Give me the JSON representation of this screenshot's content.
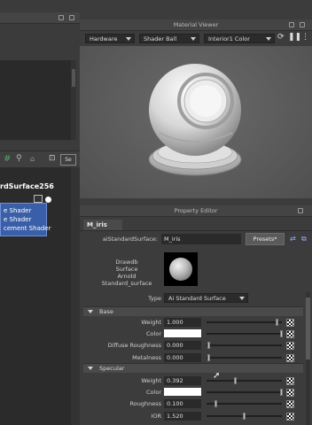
{
  "material_viewer": {
    "title": "Material Viewer",
    "renderer": "Hardware",
    "geometry": "Shader Ball",
    "environment": "Interior1 Color"
  },
  "hypershade_left": {
    "node_title": "rdSurface256",
    "node_rows": [
      "e Shader",
      "e Shader",
      "cement Shader"
    ],
    "toolbar_button": "Se"
  },
  "property_editor": {
    "title": "Property Editor",
    "tab": "M_iris",
    "node_type_label": "aiStandardSurface:",
    "node_name": "M_iris",
    "presets_label": "Presets*",
    "swatch_caption": [
      "Drawdb",
      "Surface",
      "Arnold",
      "Standard_surface"
    ],
    "type_label": "Type",
    "type_value": "Ai Standard Surface",
    "sections": {
      "base": {
        "title": "Base",
        "weight_label": "Weight",
        "weight_value": "1.000",
        "color_label": "Color",
        "diffuse_roughness_label": "Diffuse Roughness",
        "diffuse_roughness_value": "0.000",
        "metalness_label": "Metalness",
        "metalness_value": "0.000"
      },
      "specular": {
        "title": "Specular",
        "weight_label": "Weight",
        "weight_value": "0.392",
        "color_label": "Color",
        "roughness_label": "Roughness",
        "roughness_value": "0.100",
        "ior_label": "IOR",
        "ior_value": "1.520"
      }
    }
  },
  "colors": {
    "panel_bg": "#3c3c3c",
    "viewport_bg": "#5f5f5f",
    "node_blue": "#3a5fa8",
    "swatch_white": "#ffffff"
  }
}
